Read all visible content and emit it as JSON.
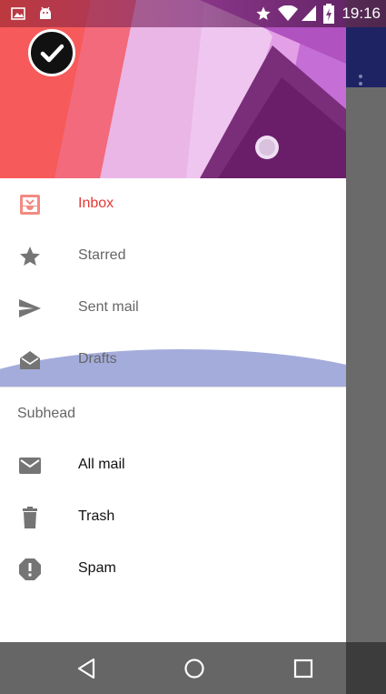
{
  "status_bar": {
    "time": "19:16",
    "icons": [
      "image-icon",
      "android-debug-icon",
      "star-icon",
      "wifi-icon",
      "signal-icon",
      "battery-charging-icon"
    ]
  },
  "drawer": {
    "avatar_icon": "check-icon",
    "primary_items": [
      {
        "label": "Inbox",
        "icon": "inbox-icon",
        "selected": true
      },
      {
        "label": "Starred",
        "icon": "star-icon",
        "selected": false
      },
      {
        "label": "Sent mail",
        "icon": "send-icon",
        "selected": false
      },
      {
        "label": "Drafts",
        "icon": "drafts-icon",
        "selected": false
      }
    ],
    "subhead": "Subhead",
    "secondary_items": [
      {
        "label": "All mail",
        "icon": "mail-icon"
      },
      {
        "label": "Trash",
        "icon": "trash-icon"
      },
      {
        "label": "Spam",
        "icon": "report-icon"
      }
    ]
  },
  "navigation_bar": {
    "buttons": [
      "back-icon",
      "home-icon",
      "recents-icon"
    ]
  },
  "colors": {
    "accent": "#e53935",
    "ripple": "#9fa8da",
    "toolbar": "#1d2363"
  }
}
